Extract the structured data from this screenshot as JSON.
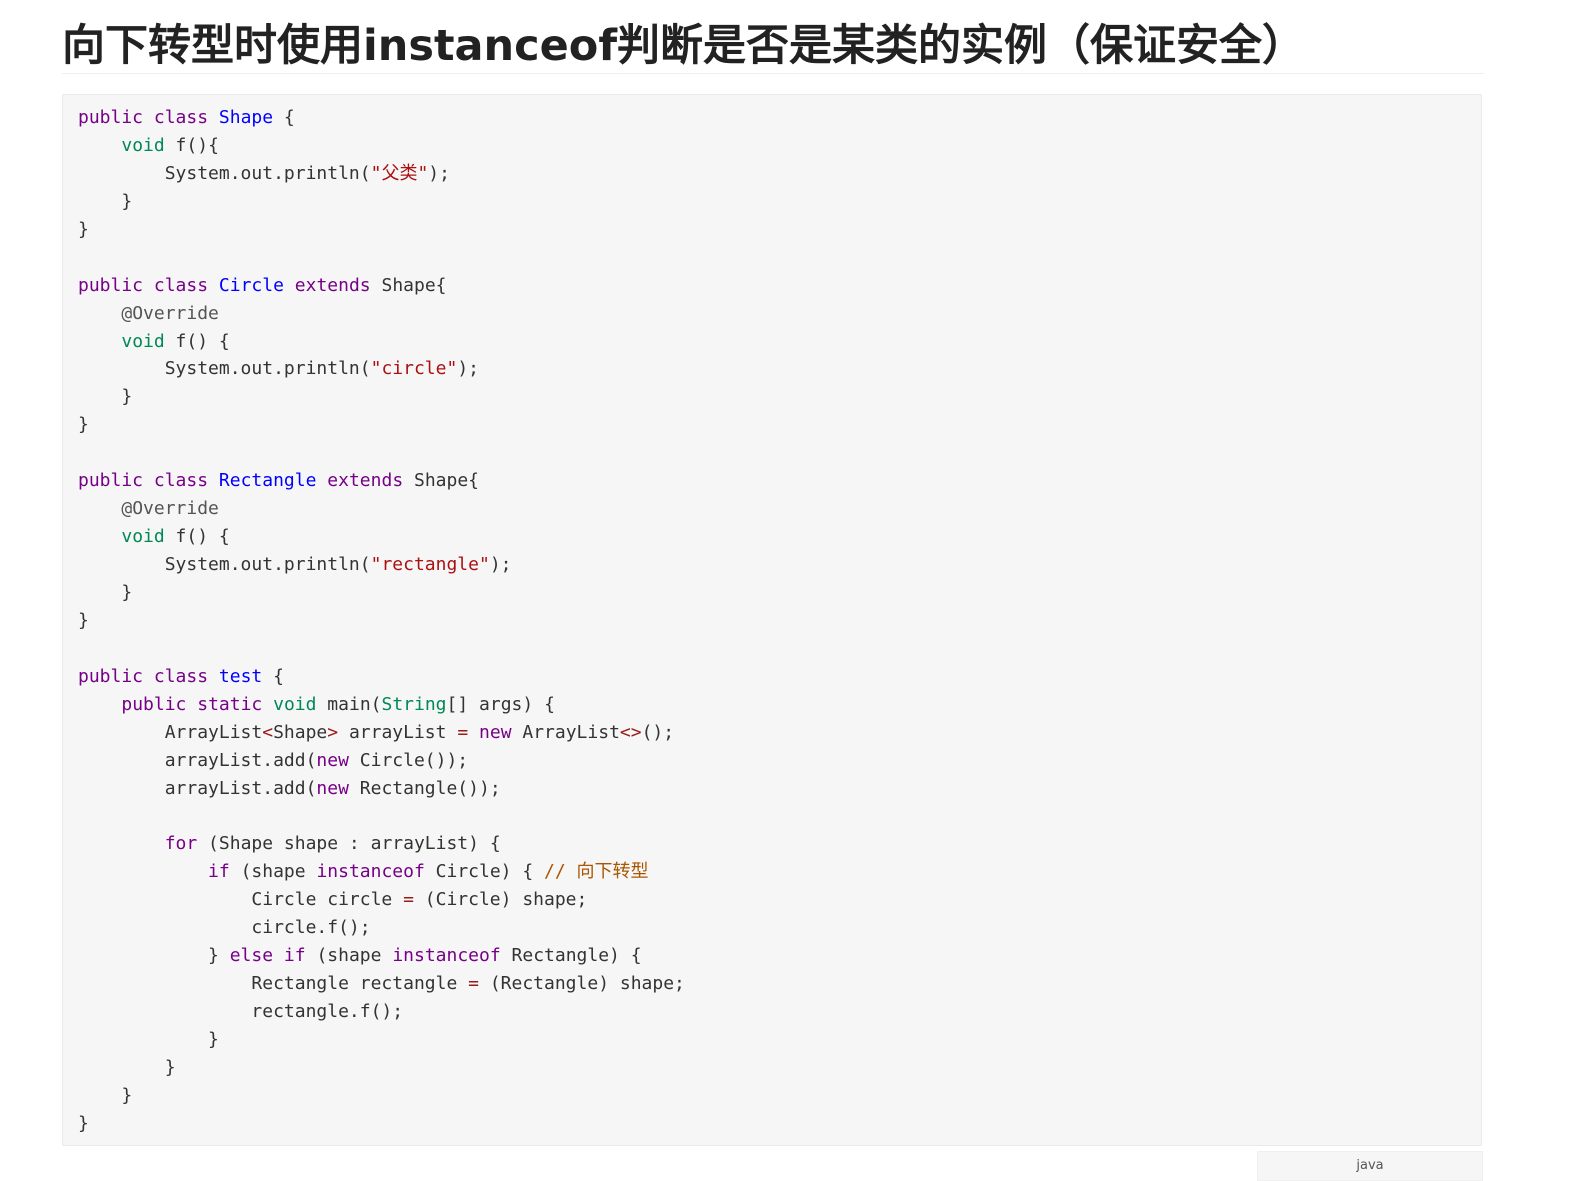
{
  "article": {
    "title": "向下转型时使用instanceof判断是否是某类的实例（保证安全）"
  },
  "code_block": {
    "language_label": "java",
    "lines": [
      [
        [
          "k",
          "public"
        ],
        [
          "p",
          " "
        ],
        [
          "k",
          "class"
        ],
        [
          "p",
          " "
        ],
        [
          "d",
          "Shape"
        ],
        [
          "p",
          " {"
        ]
      ],
      [
        [
          "p",
          "    "
        ],
        [
          "t",
          "void"
        ],
        [
          "p",
          " f(){"
        ]
      ],
      [
        [
          "p",
          "        System.out.println("
        ],
        [
          "s",
          "\"父类\""
        ],
        [
          "p",
          ");"
        ]
      ],
      [
        [
          "p",
          "    }"
        ]
      ],
      [
        [
          "p",
          "}"
        ]
      ],
      [],
      [
        [
          "k",
          "public"
        ],
        [
          "p",
          " "
        ],
        [
          "k",
          "class"
        ],
        [
          "p",
          " "
        ],
        [
          "d",
          "Circle"
        ],
        [
          "p",
          " "
        ],
        [
          "k",
          "extends"
        ],
        [
          "p",
          " Shape{"
        ]
      ],
      [
        [
          "p",
          "    "
        ],
        [
          "m",
          "@Override"
        ]
      ],
      [
        [
          "p",
          "    "
        ],
        [
          "t",
          "void"
        ],
        [
          "p",
          " f() {"
        ]
      ],
      [
        [
          "p",
          "        System.out.println("
        ],
        [
          "s",
          "\"circle\""
        ],
        [
          "p",
          ");"
        ]
      ],
      [
        [
          "p",
          "    }"
        ]
      ],
      [
        [
          "p",
          "}"
        ]
      ],
      [],
      [
        [
          "k",
          "public"
        ],
        [
          "p",
          " "
        ],
        [
          "k",
          "class"
        ],
        [
          "p",
          " "
        ],
        [
          "d",
          "Rectangle"
        ],
        [
          "p",
          " "
        ],
        [
          "k",
          "extends"
        ],
        [
          "p",
          " Shape{"
        ]
      ],
      [
        [
          "p",
          "    "
        ],
        [
          "m",
          "@Override"
        ]
      ],
      [
        [
          "p",
          "    "
        ],
        [
          "t",
          "void"
        ],
        [
          "p",
          " f() {"
        ]
      ],
      [
        [
          "p",
          "        System.out.println("
        ],
        [
          "s",
          "\"rectangle\""
        ],
        [
          "p",
          ");"
        ]
      ],
      [
        [
          "p",
          "    }"
        ]
      ],
      [
        [
          "p",
          "}"
        ]
      ],
      [],
      [
        [
          "k",
          "public"
        ],
        [
          "p",
          " "
        ],
        [
          "k",
          "class"
        ],
        [
          "p",
          " "
        ],
        [
          "d",
          "test"
        ],
        [
          "p",
          " {"
        ]
      ],
      [
        [
          "p",
          "    "
        ],
        [
          "k",
          "public"
        ],
        [
          "p",
          " "
        ],
        [
          "k",
          "static"
        ],
        [
          "p",
          " "
        ],
        [
          "t",
          "void"
        ],
        [
          "p",
          " main("
        ],
        [
          "t",
          "String"
        ],
        [
          "p",
          "[] args) {"
        ]
      ],
      [
        [
          "p",
          "        ArrayList"
        ],
        [
          "o",
          "<"
        ],
        [
          "p",
          "Shape"
        ],
        [
          "o",
          ">"
        ],
        [
          "p",
          " arrayList "
        ],
        [
          "o",
          "="
        ],
        [
          "p",
          " "
        ],
        [
          "k",
          "new"
        ],
        [
          "p",
          " ArrayList"
        ],
        [
          "o",
          "<>"
        ],
        [
          "p",
          "();"
        ]
      ],
      [
        [
          "p",
          "        arrayList.add("
        ],
        [
          "k",
          "new"
        ],
        [
          "p",
          " Circle());"
        ]
      ],
      [
        [
          "p",
          "        arrayList.add("
        ],
        [
          "k",
          "new"
        ],
        [
          "p",
          " Rectangle());"
        ]
      ],
      [],
      [
        [
          "p",
          "        "
        ],
        [
          "k",
          "for"
        ],
        [
          "p",
          " (Shape shape : arrayList) {"
        ]
      ],
      [
        [
          "p",
          "            "
        ],
        [
          "k",
          "if"
        ],
        [
          "p",
          " (shape "
        ],
        [
          "k",
          "instanceof"
        ],
        [
          "p",
          " Circle) { "
        ],
        [
          "c",
          "// 向下转型"
        ]
      ],
      [
        [
          "p",
          "                Circle circle "
        ],
        [
          "o",
          "="
        ],
        [
          "p",
          " (Circle) shape;"
        ]
      ],
      [
        [
          "p",
          "                circle.f();"
        ]
      ],
      [
        [
          "p",
          "            } "
        ],
        [
          "k",
          "else"
        ],
        [
          "p",
          " "
        ],
        [
          "k",
          "if"
        ],
        [
          "p",
          " (shape "
        ],
        [
          "k",
          "instanceof"
        ],
        [
          "p",
          " Rectangle) {"
        ]
      ],
      [
        [
          "p",
          "                Rectangle rectangle "
        ],
        [
          "o",
          "="
        ],
        [
          "p",
          " (Rectangle) shape;"
        ]
      ],
      [
        [
          "p",
          "                rectangle.f();"
        ]
      ],
      [
        [
          "p",
          "            }"
        ]
      ],
      [
        [
          "p",
          "        }"
        ]
      ],
      [
        [
          "p",
          "    }"
        ]
      ],
      [
        [
          "p",
          "}"
        ]
      ]
    ]
  }
}
